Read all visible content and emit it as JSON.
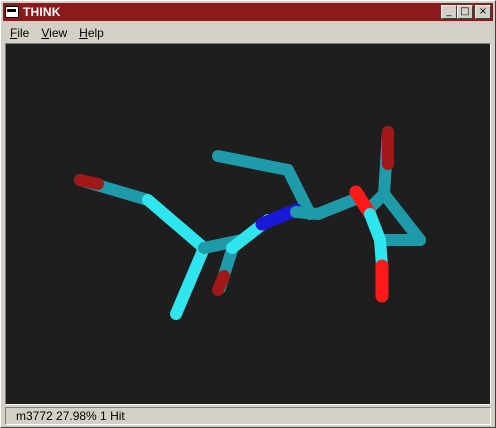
{
  "window": {
    "title": "THINK",
    "controls": {
      "minimize": "_",
      "maximize": "□",
      "close": "×"
    }
  },
  "menu": {
    "file": {
      "key": "F",
      "rest": "ile"
    },
    "view": {
      "key": "V",
      "rest": "iew"
    },
    "help": {
      "key": "H",
      "rest": "elp"
    }
  },
  "viewport": {
    "background": "#1e1e1e",
    "colors": {
      "carbon_light": "#2fe6ee",
      "carbon_dark": "#1f9aa8",
      "nitrogen": "#1818d8",
      "oxygen": "#ff1a1a",
      "oxygen_dark": "#a01818"
    }
  },
  "status": {
    "text": "m3772 27.98% 1 Hit"
  }
}
